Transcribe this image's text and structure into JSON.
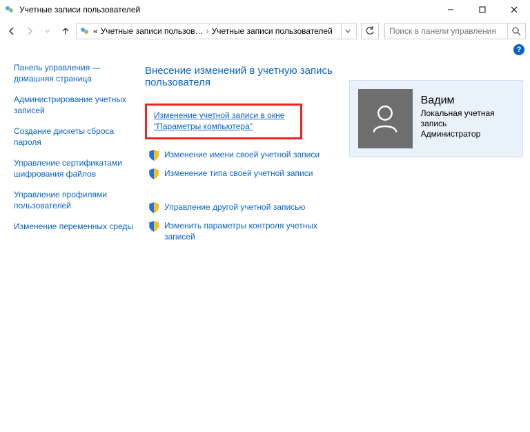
{
  "window": {
    "title": "Учетные записи пользователей"
  },
  "breadcrumb": {
    "prefix": "«",
    "part1": "Учетные записи пользов…",
    "part2": "Учетные записи пользователей"
  },
  "search": {
    "placeholder": "Поиск в панели управления"
  },
  "sidebar": {
    "items": [
      {
        "label": "Панель управления — домашняя страница"
      },
      {
        "label": "Администрирование учетных записей"
      },
      {
        "label": "Создание дискеты сброса пароля"
      },
      {
        "label": "Управление сертификатами шифрования файлов"
      },
      {
        "label": "Управление профилями пользователей"
      },
      {
        "label": "Изменение переменных среды"
      }
    ]
  },
  "main": {
    "heading": "Внесение изменений в учетную запись пользователя",
    "highlight": {
      "line1": "Изменение учетной записи в окне",
      "line2": "\"Параметры компьютера\""
    },
    "actions_a": [
      {
        "label": "Изменение имени своей учетной записи"
      },
      {
        "label": "Изменение типа своей учетной записи"
      }
    ],
    "actions_b": [
      {
        "label": "Управление другой учетной записью"
      },
      {
        "label": "Изменить параметры контроля учетных записей"
      }
    ]
  },
  "user": {
    "name": "Вадим",
    "account_type": "Локальная учетная запись",
    "role": "Администратор"
  },
  "glyphs": {
    "question": "?"
  }
}
